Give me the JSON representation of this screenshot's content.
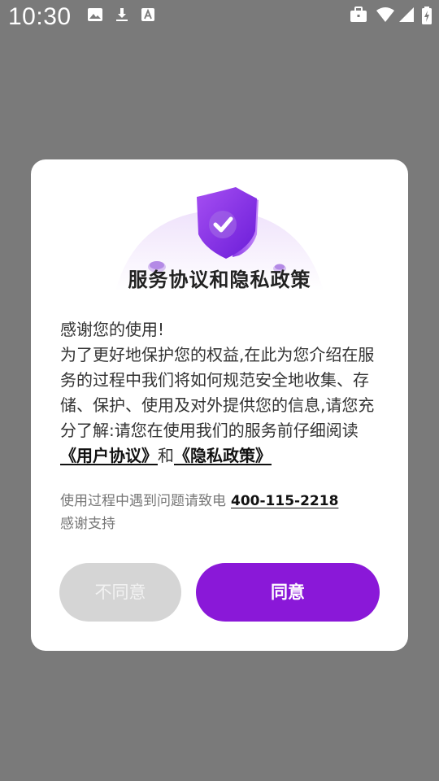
{
  "status_bar": {
    "time": "10:30",
    "left_icons": [
      "image-icon",
      "download-icon",
      "font-a-icon"
    ],
    "right_icons": [
      "briefcase-icon",
      "wifi-icon",
      "signal-icon",
      "battery-charging-icon"
    ]
  },
  "dialog": {
    "hero_icon": "shield-check-icon",
    "title": "服务协议和隐私政策",
    "greeting": "感谢您的使用!",
    "body": "为了更好地保护您的权益,在此为您介绍在服务的过程中我们将如何规范安全地收集、存储、保护、使用及对外提供您的信息,请您充分了解:请您在使用我们的服务前仔细阅读",
    "user_agreement_link": "《用户协议》",
    "conjunction": "和",
    "privacy_policy_link": "《隐私政策》",
    "contact_prefix": "使用过程中遇到问题请致电",
    "contact_phone": "400-115-2218",
    "thanks": "感谢支持",
    "disagree_label": "不同意",
    "agree_label": "同意"
  },
  "colors": {
    "accent": "#8a18d8",
    "overlay": "#7a7a7a",
    "disagree_bg": "#d5d5d5"
  }
}
